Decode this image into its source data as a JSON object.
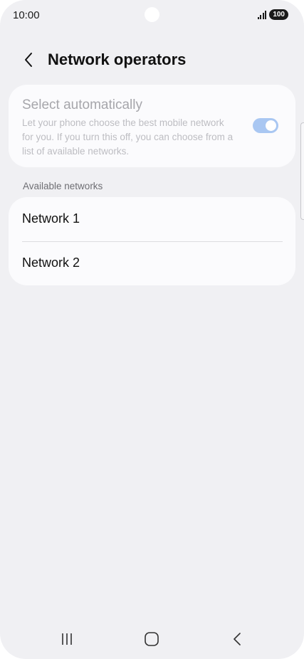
{
  "status_bar": {
    "time": "10:00",
    "battery": "100"
  },
  "header": {
    "title": "Network operators",
    "back_icon": "chevron-left-icon"
  },
  "auto_select": {
    "title": "Select automatically",
    "description": "Let your phone choose the best mobile network for you. If you turn this off, you can choose from a list of available networks.",
    "enabled": true,
    "toggle_color": "#a9c7f2"
  },
  "available_networks": {
    "label": "Available networks",
    "items": [
      {
        "label": "Network 1"
      },
      {
        "label": "Network 2"
      }
    ]
  },
  "nav_bar": {
    "recents_icon": "recents-icon",
    "home_icon": "home-icon",
    "back_icon": "back-icon"
  }
}
